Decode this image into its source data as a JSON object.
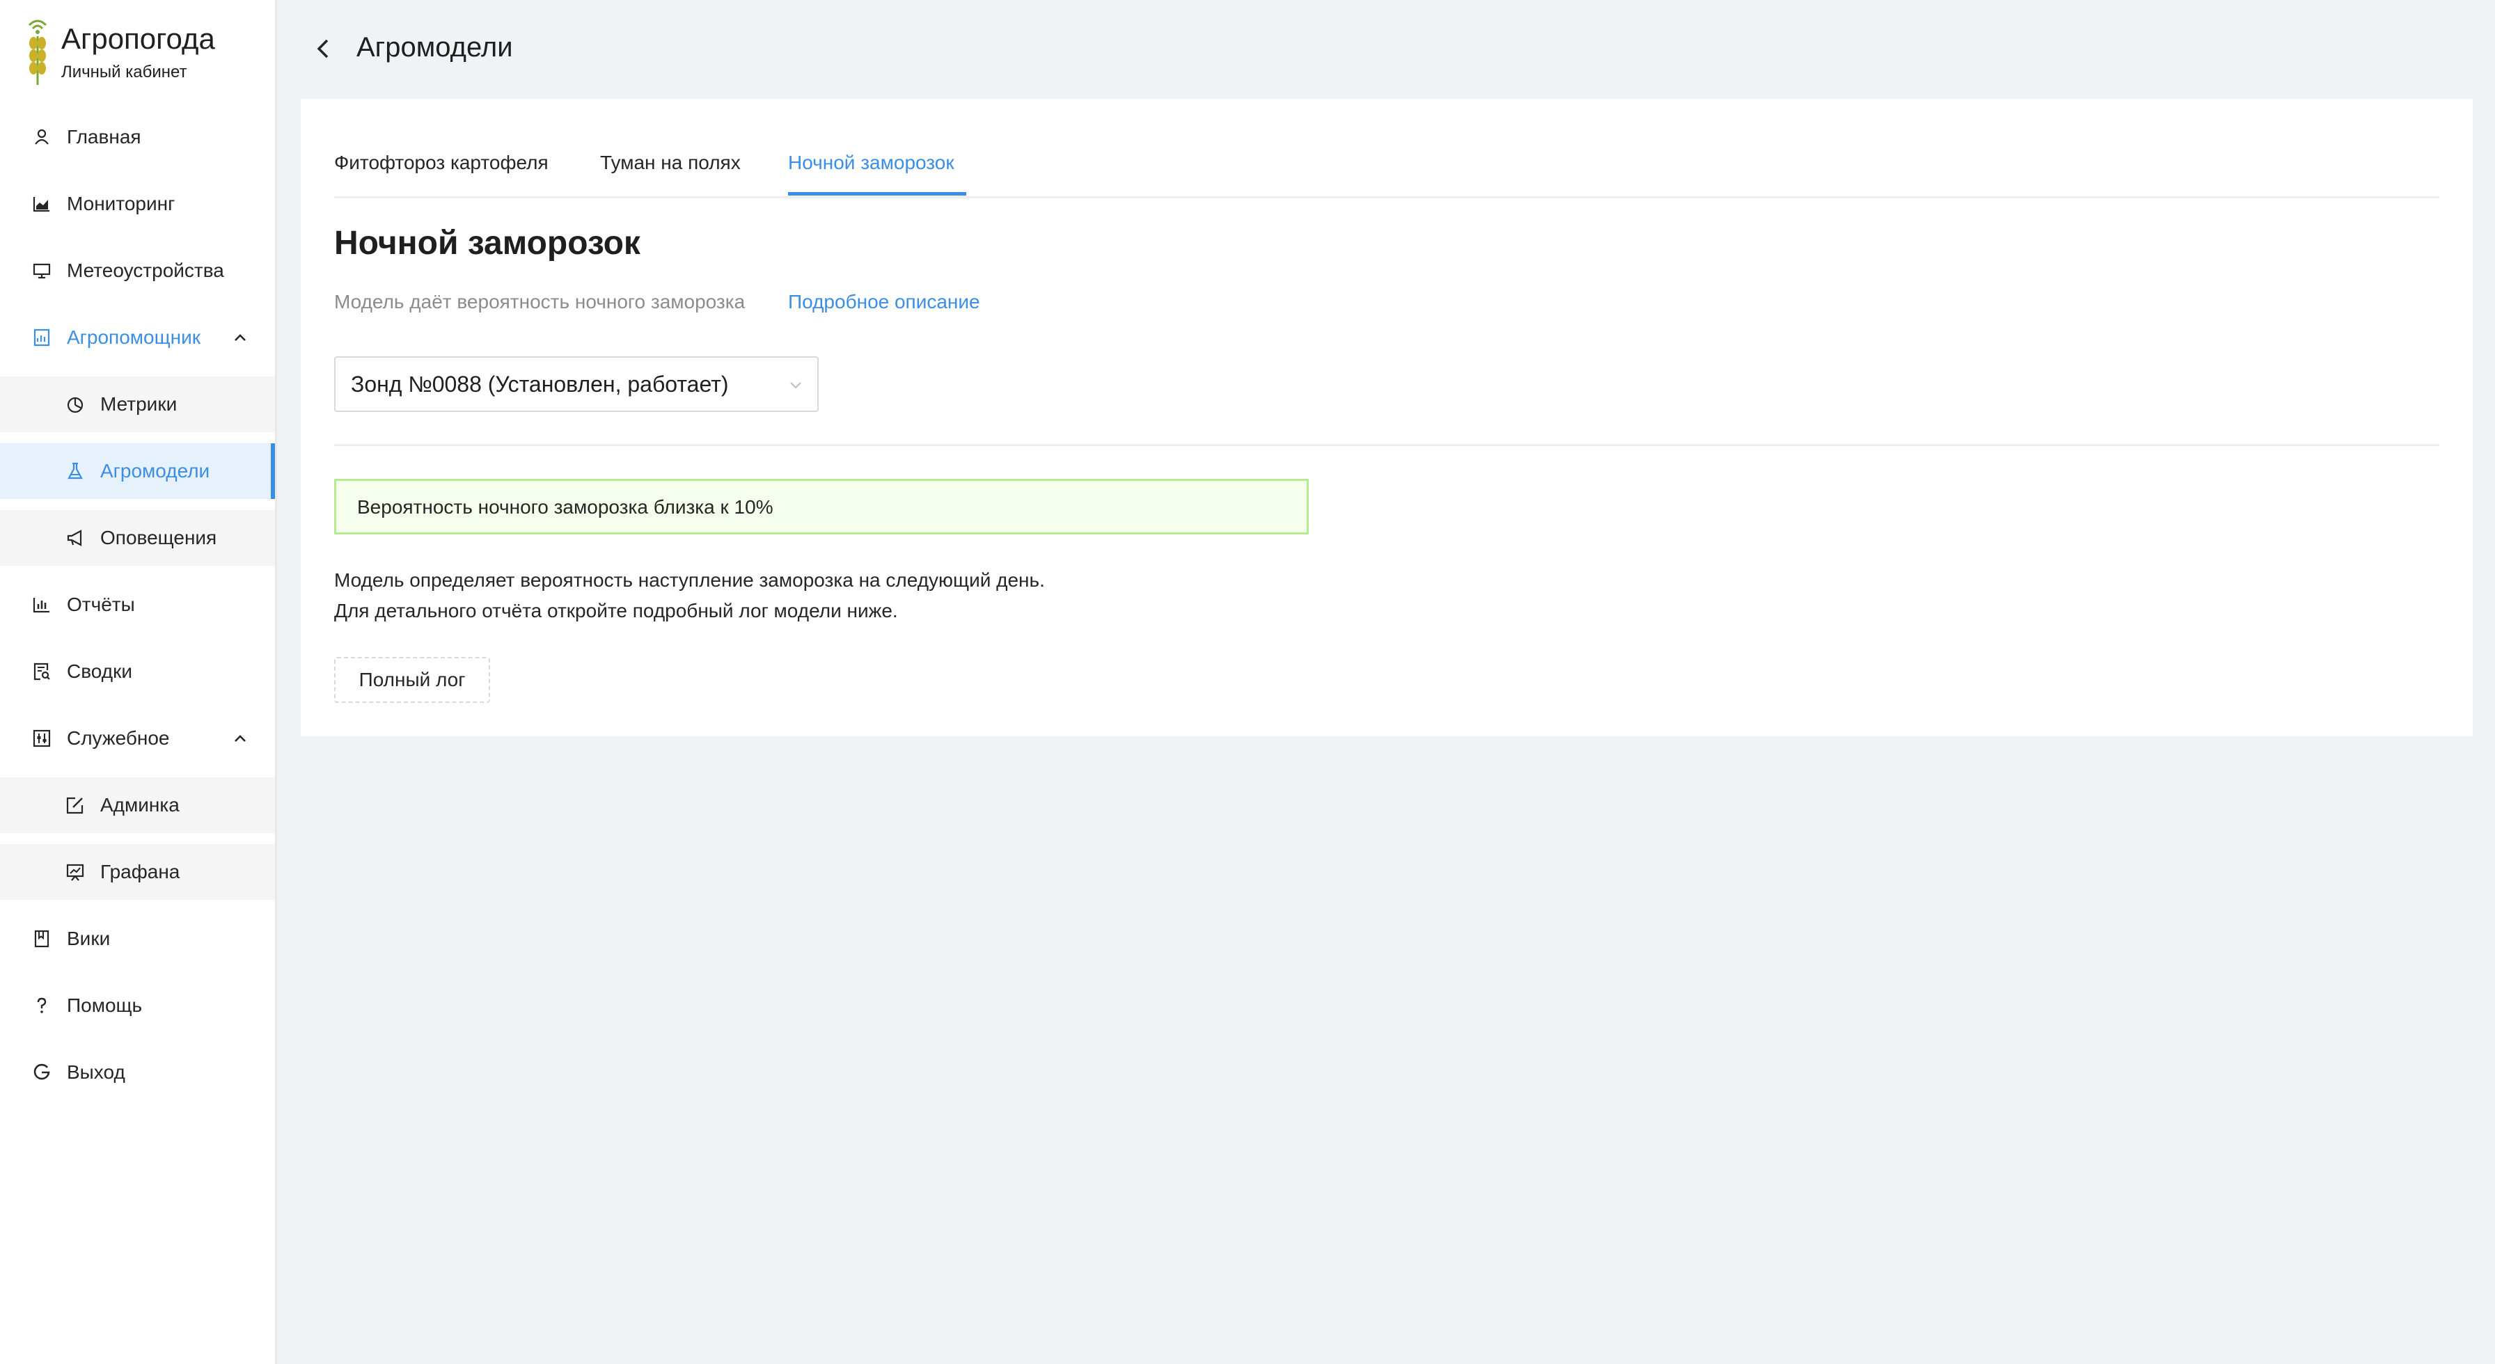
{
  "brand": {
    "title": "Агропогода",
    "subtitle": "Личный кабинет"
  },
  "sidebar": {
    "items": [
      {
        "label": "Главная",
        "icon": "user-icon"
      },
      {
        "label": "Мониторинг",
        "icon": "area-chart-icon"
      },
      {
        "label": "Метеоустройства",
        "icon": "desktop-icon"
      },
      {
        "label": "Агропомощник",
        "icon": "report-icon",
        "expanded": true
      },
      {
        "label": "Метрики",
        "icon": "pie-chart-icon"
      },
      {
        "label": "Агромодели",
        "icon": "flask-icon",
        "active": true
      },
      {
        "label": "Оповещения",
        "icon": "megaphone-icon"
      },
      {
        "label": "Отчёты",
        "icon": "bar-chart-icon"
      },
      {
        "label": "Сводки",
        "icon": "file-search-icon"
      },
      {
        "label": "Служебное",
        "icon": "control-icon",
        "expanded": true
      },
      {
        "label": "Админка",
        "icon": "edit-square-icon"
      },
      {
        "label": "Графана",
        "icon": "fund-projection-icon"
      },
      {
        "label": "Вики",
        "icon": "book-icon"
      },
      {
        "label": "Помощь",
        "icon": "question-icon"
      },
      {
        "label": "Выход",
        "icon": "google-icon"
      }
    ]
  },
  "header": {
    "title": "Агромодели"
  },
  "tabs": [
    {
      "label": "Фитофтороз картофеля"
    },
    {
      "label": "Туман на полях"
    },
    {
      "label": "Ночной заморозок",
      "active": true
    }
  ],
  "model": {
    "title": "Ночной заморозок",
    "description": "Модель даёт вероятность ночного заморозка",
    "details_link": "Подробное описание",
    "device_select": "Зонд №0088 (Установлен, работает)",
    "alert": "Вероятность ночного заморозка близка к 10%",
    "body_lines": [
      "Модель определяет вероятность наступление заморозка на следующий день.",
      "Для детального отчёта откройте подробный лог модели ниже."
    ],
    "log_button": "Полный лог"
  },
  "colors": {
    "accent": "#3a8ee6",
    "active_bg": "#e6f1fc",
    "page_bg": "#f0f2f5",
    "alert_bg": "#f6ffed",
    "alert_border": "#b7eb8f",
    "logo_green": "#7aa832",
    "logo_gold": "#c9b22a"
  }
}
